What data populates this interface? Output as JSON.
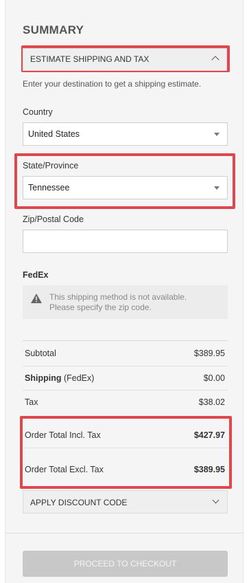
{
  "summary": {
    "title": "SUMMARY",
    "estimate_header": "ESTIMATE SHIPPING AND TAX",
    "hint": "Enter your destination to get a shipping estimate."
  },
  "form": {
    "country_label": "Country",
    "country_value": "United States",
    "state_label": "State/Province",
    "state_value": "Tennessee",
    "zip_label": "Zip/Postal Code",
    "zip_value": ""
  },
  "shipping": {
    "carrier": "FedEx",
    "notice_line1": "This shipping method is not available.",
    "notice_line2": "Please specify the zip code."
  },
  "totals": {
    "subtotal_label": "Subtotal",
    "subtotal_value": "$389.95",
    "shipping_label": "Shipping",
    "shipping_carrier": "(FedEx)",
    "shipping_value": "$0.00",
    "tax_label": "Tax",
    "tax_value": "$38.02",
    "incl_label": "Order Total Incl. Tax",
    "incl_value": "$427.97",
    "excl_label": "Order Total Excl. Tax",
    "excl_value": "$389.95"
  },
  "discount": {
    "label": "APPLY DISCOUNT CODE"
  },
  "checkout": {
    "label": "PROCEED TO CHECKOUT"
  },
  "colors": {
    "highlight": "#e0474c",
    "panel": "#f5f5f5",
    "button_disabled": "#c8c8c8"
  }
}
